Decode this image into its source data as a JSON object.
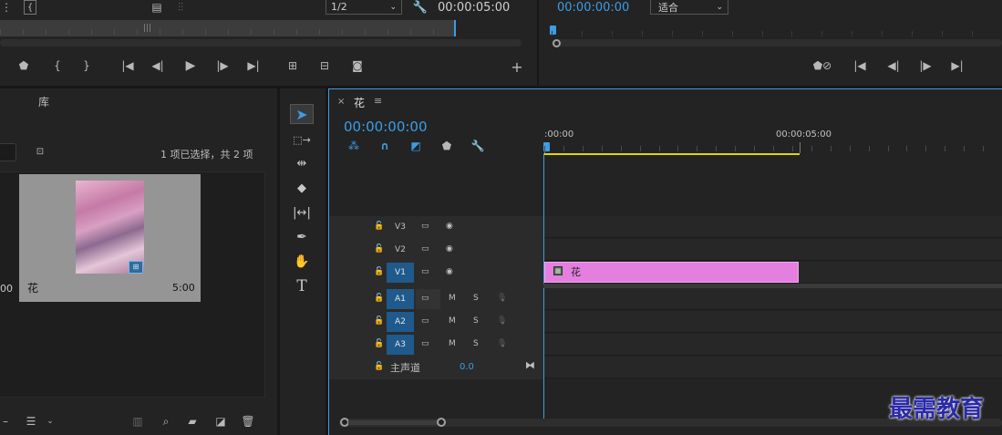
{
  "source_monitor": {
    "resolution": "1/2",
    "timecode": "00:00:05:00"
  },
  "program_monitor": {
    "timecode": "00:00:00:00",
    "zoom": "适合"
  },
  "project_panel": {
    "tab_label": "库",
    "selection_info": "1 项已选择，共 2 项",
    "item": {
      "name": "花",
      "duration": "5:00",
      "left_partial_duration": "00"
    }
  },
  "timeline": {
    "sequence_name": "花",
    "timecode": "00:00:00:00",
    "ruler_start": ":00:00",
    "ruler_mark": "00:00:05:00",
    "video_tracks": [
      "V3",
      "V2",
      "V1"
    ],
    "audio_tracks": [
      "A1",
      "A2",
      "A3"
    ],
    "mute_label": "M",
    "solo_label": "S",
    "master_label": "主声道",
    "master_value": "0.0",
    "clip_name": "花",
    "clip_color": "#e47fe0"
  },
  "watermark": "最需教育",
  "colors": {
    "accent": "#3b9de6",
    "panel_bg": "#232323",
    "track_on": "#1e5a8c",
    "work_area": "#e3d400"
  }
}
